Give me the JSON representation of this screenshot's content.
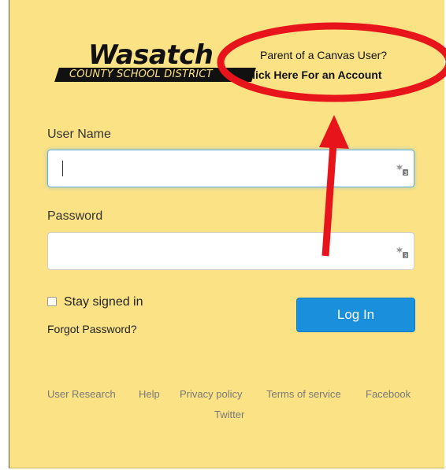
{
  "logo": {
    "word": "Wasatch",
    "subtitle": "COUNTY SCHOOL DISTRICT"
  },
  "parent": {
    "question": "Parent of a Canvas User?",
    "link": "Click Here For an Account"
  },
  "form": {
    "username_label": "User Name",
    "username_value": "",
    "password_label": "Password",
    "password_value": "",
    "stay_signed_in": "Stay signed in",
    "stay_signed_in_checked": false,
    "forgot_password": "Forgot Password?",
    "login_button": "Log In",
    "field_icon": "password-manager-key-icon"
  },
  "footer": {
    "links": [
      "User Research",
      "Help",
      "Privacy policy",
      "Terms of service",
      "Facebook",
      "Twitter"
    ]
  },
  "colors": {
    "panel_bg": "#fbe385",
    "login_button": "#1a8fdc",
    "annotation": "#e8141c"
  }
}
